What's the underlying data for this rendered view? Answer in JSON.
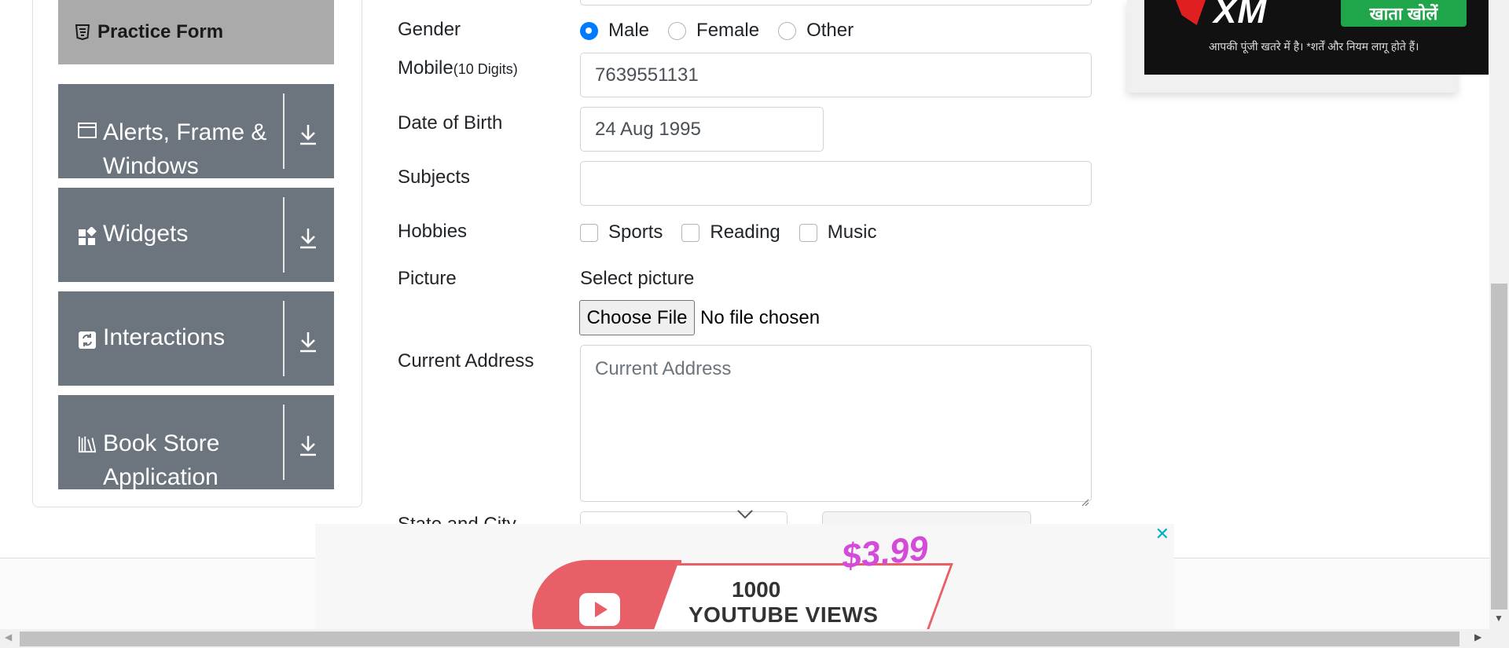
{
  "sidebar": {
    "practice_form": "Practice Form",
    "groups": [
      {
        "label": "Alerts, Frame & Windows",
        "icon": "window-icon"
      },
      {
        "label": "Widgets",
        "icon": "widgets-icon"
      },
      {
        "label": "Interactions",
        "icon": "interactions-icon"
      },
      {
        "label": "Book Store Application",
        "icon": "books-icon"
      }
    ]
  },
  "form": {
    "gender": {
      "label": "Gender",
      "options": [
        "Male",
        "Female",
        "Other"
      ],
      "selected": "Male"
    },
    "mobile": {
      "label": "Mobile",
      "hint": "(10 Digits)",
      "value": "7639551131"
    },
    "dob": {
      "label": "Date of Birth",
      "value": "24 Aug 1995"
    },
    "subjects": {
      "label": "Subjects",
      "value": ""
    },
    "hobbies": {
      "label": "Hobbies",
      "options": [
        "Sports",
        "Reading",
        "Music"
      ]
    },
    "picture": {
      "label": "Picture",
      "select_text": "Select picture",
      "button": "Choose File",
      "status": "No file chosen"
    },
    "address": {
      "label": "Current Address",
      "placeholder": "Current Address"
    },
    "state_city": {
      "label": "State and City"
    }
  },
  "ads": {
    "top": {
      "brand": "XM",
      "cta": "खाता खोलें",
      "disclaimer": "आपकी पूंजी खतरे में है। *शर्तें और नियम लागू होते हैं।"
    },
    "bottom": {
      "price": "$3.99",
      "line1": "1000",
      "line2": "YOUTUBE VIEWS",
      "close": "✕"
    }
  },
  "colors": {
    "sidebar_group": "#6c757d",
    "sidebar_active": "#aaaaaa",
    "radio_checked": "#007bff"
  }
}
